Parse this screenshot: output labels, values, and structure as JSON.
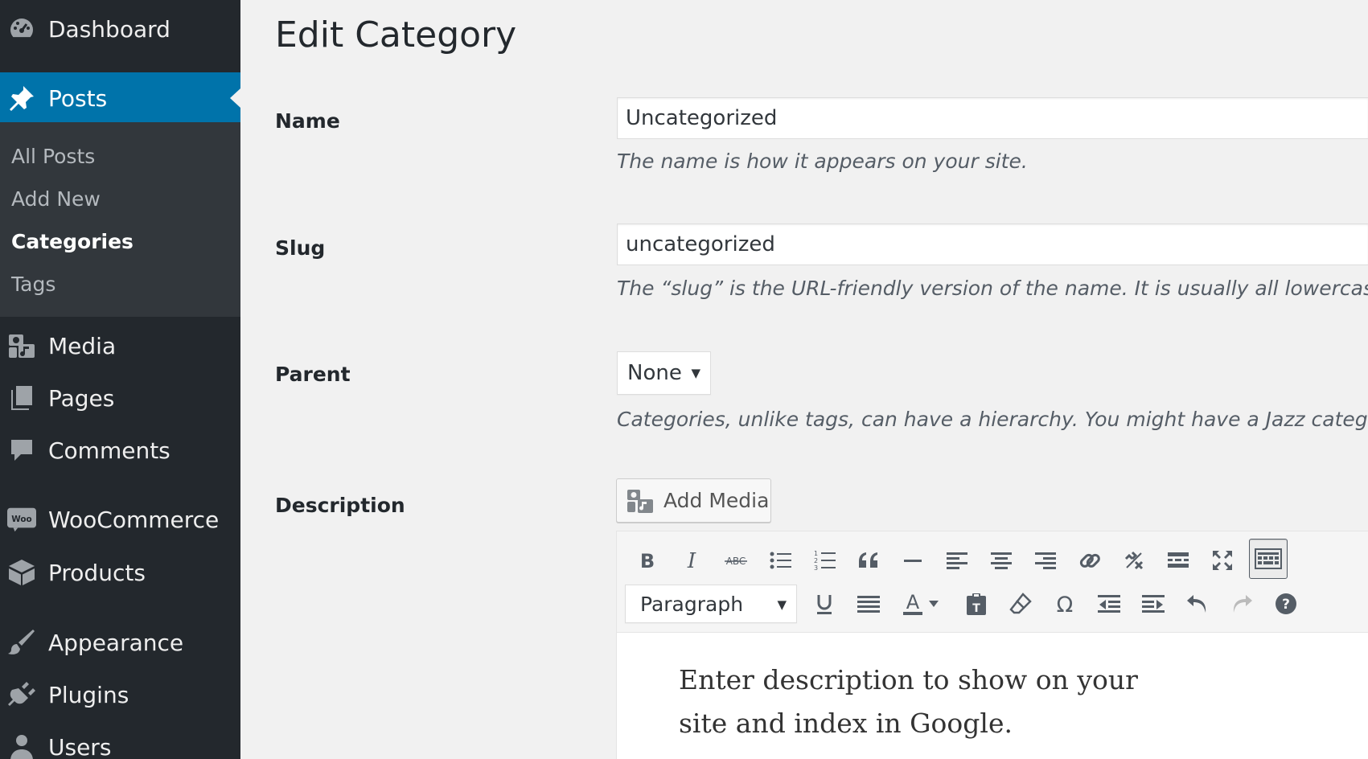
{
  "sidebar": {
    "dashboard": {
      "label": "Dashboard",
      "icon": "dashboard-icon"
    },
    "posts": {
      "label": "Posts",
      "icon": "pin-icon"
    },
    "submenu": [
      {
        "label": "All Posts"
      },
      {
        "label": "Add New"
      },
      {
        "label": "Categories",
        "current": true
      },
      {
        "label": "Tags"
      }
    ],
    "media": {
      "label": "Media",
      "icon": "media-icon"
    },
    "pages": {
      "label": "Pages",
      "icon": "pages-icon"
    },
    "comments": {
      "label": "Comments",
      "icon": "comment-icon"
    },
    "woocommerce": {
      "label": "WooCommerce",
      "icon": "woo-icon",
      "icon_text": "Woo"
    },
    "products": {
      "label": "Products",
      "icon": "products-box-icon"
    },
    "appearance": {
      "label": "Appearance",
      "icon": "paintbrush-icon"
    },
    "plugins": {
      "label": "Plugins",
      "icon": "plug-icon"
    },
    "users": {
      "label": "Users",
      "icon": "user-icon"
    }
  },
  "colors": {
    "sidebar_bg": "#23282d",
    "submenu_bg": "#32373c",
    "accent": "#0073aa",
    "page_bg": "#f1f1f1"
  },
  "main": {
    "title": "Edit Category",
    "name": {
      "label": "Name",
      "value": "Uncategorized",
      "help": "The name is how it appears on your site."
    },
    "slug": {
      "label": "Slug",
      "value": "uncategorized",
      "help": "The “slug” is the URL-friendly version of the name. It is usually all lowercase and"
    },
    "parent": {
      "label": "Parent",
      "selected": "None",
      "help": "Categories, unlike tags, can have a hierarchy. You might have a Jazz category, ar"
    },
    "description": {
      "label": "Description",
      "add_media_label": "Add Media",
      "format_selected": "Paragraph",
      "text_color_letter": "A",
      "content": "Enter description to show on your site and index in Google."
    }
  }
}
